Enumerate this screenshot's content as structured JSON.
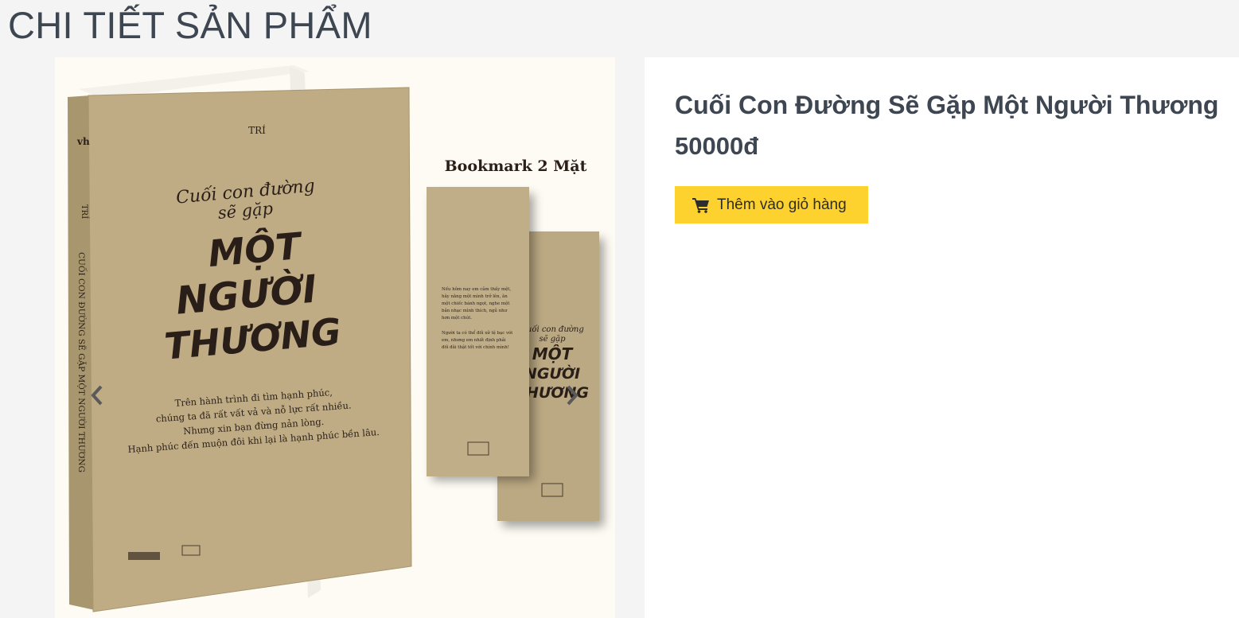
{
  "page": {
    "title": "CHI TIẾT SẢN PHẨM"
  },
  "product": {
    "name": "Cuối Con Đường Sẽ Gặp Một Người Thương",
    "price": "50000đ"
  },
  "actions": {
    "add_to_cart_label": "Thêm vào giỏ hàng"
  },
  "gallery": {
    "cover": {
      "author": "TRÍ",
      "title_top_1": "Cuối con đường",
      "title_top_2": "sẽ gặp",
      "title_big_1": "MỘT",
      "title_big_2": "NGƯỜI",
      "title_big_3": "THƯƠNG",
      "blurb_1": "Trên hành trình đi tìm hạnh phúc,",
      "blurb_2": "chúng ta đã rất vất vả và nỗ lực rất nhiều.",
      "blurb_3": "Nhưng xin bạn đừng nản lòng.",
      "blurb_4": "Hạnh phúc đến muộn đôi khi lại là hạnh phúc bền lâu.",
      "spine_author": "TRÍ",
      "spine_title": "CUỐI CON ĐƯỜNG SẼ GẶP MỘT NGƯỜI THƯƠNG",
      "spine_logo": "vh"
    },
    "bookmark": {
      "heading": "Bookmark 2 Mặt",
      "text_1": "Nếu hôm nay em cảm thấy mệt,",
      "text_2": "hãy nằng một mình trở lên, ăn",
      "text_3": "một chiếc bánh ngọt, nghe một",
      "text_4": "bản nhạc mình thích, ngủ như",
      "text_5": "hơn một chút.",
      "text_6": "Người ta có thể đối xử tệ bạc với",
      "text_7": "em, nhưng em nhất định phải",
      "text_8": "đối đãi thật tốt với chính mình!",
      "back_1": "Cuối con đường",
      "back_2": "sẽ gặp",
      "back_3": "MỘT",
      "back_4": "NGƯỜI",
      "back_5": "THƯƠNG"
    }
  },
  "colors": {
    "title": "#3d4651",
    "button": "#fdd12e",
    "kraft": "#bfac85",
    "ink": "#2a1f18"
  },
  "icons": {
    "cart": "cart-icon",
    "prev": "chevron-left-icon",
    "next": "chevron-right-icon"
  }
}
